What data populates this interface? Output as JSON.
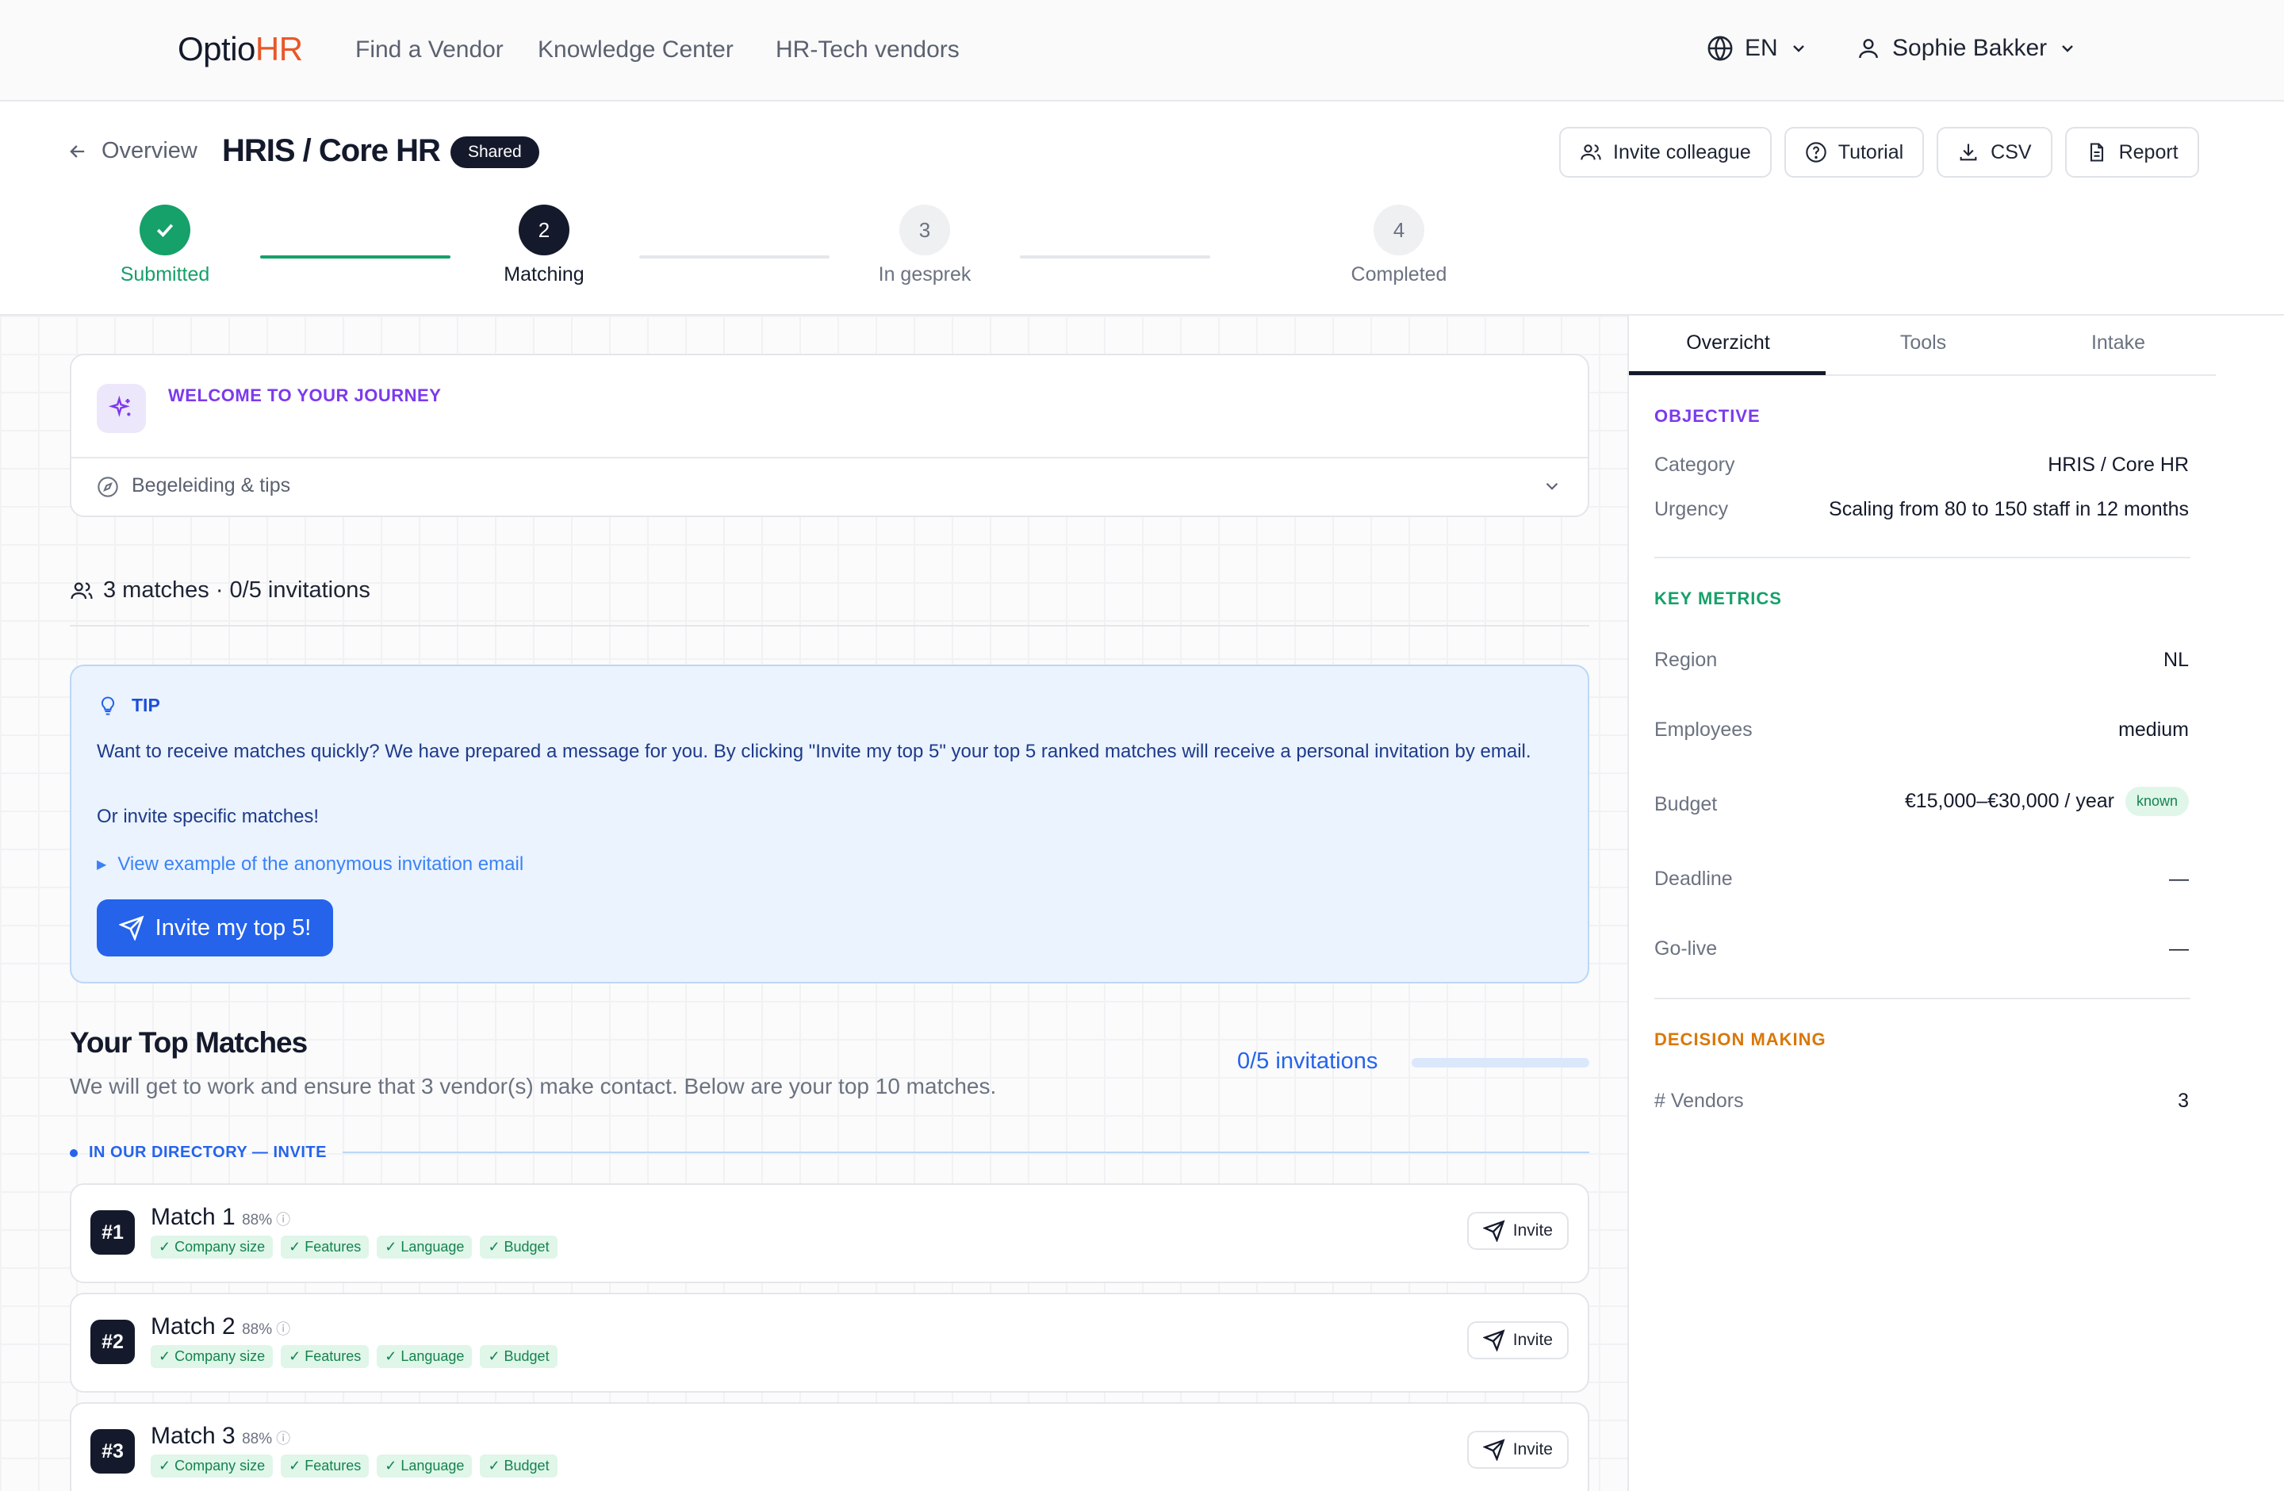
{
  "brand": {
    "part1": "Optio",
    "part2": "HR",
    "accent": "#e8572a"
  },
  "nav": {
    "items": [
      "Find a Vendor",
      "Knowledge Center",
      "HR-Tech vendors"
    ]
  },
  "lang": {
    "code": "EN"
  },
  "user": {
    "name": "Sophie Bakker"
  },
  "page": {
    "back_label": "Overview",
    "title": "HRIS / Core HR",
    "badge": "Shared"
  },
  "actions": {
    "invite": "Invite colleague",
    "tutorial": "Tutorial",
    "csv": "CSV",
    "report": "Report"
  },
  "steps": [
    {
      "num": "",
      "label": "Submitted",
      "state": "done"
    },
    {
      "num": "2",
      "label": "Matching",
      "state": "current"
    },
    {
      "num": "3",
      "label": "In gesprek",
      "state": "todo"
    },
    {
      "num": "4",
      "label": "Completed",
      "state": "todo"
    }
  ],
  "welcome": {
    "title": "WELCOME TO YOUR JOURNEY",
    "guide": "Begeleiding & tips"
  },
  "summary": {
    "text": "3 matches · 0/5 invitations"
  },
  "tip": {
    "title": "TIP",
    "line1": "Want to receive matches quickly? We have prepared a message for you. By clicking \"Invite my top 5\" your top 5 ranked matches will receive a personal invitation by email.",
    "line2": "Or invite specific matches!",
    "example": "View example of the anonymous invitation email",
    "cta": "Invite my top 5!"
  },
  "top": {
    "title": "Your Top Matches",
    "subtitle": "We will get to work and ensure that 3 vendor(s) make contact. Below are your top 10 matches.",
    "progress_label": "0/5 invitations",
    "progress": 0,
    "directory_label": "IN OUR DIRECTORY — INVITE"
  },
  "matches": [
    {
      "rank": "#1",
      "name": "Match 1",
      "score": "88%",
      "chips": [
        "✓ Company size",
        "✓ Features",
        "✓ Language",
        "✓ Budget"
      ],
      "action": "Invite"
    },
    {
      "rank": "#2",
      "name": "Match 2",
      "score": "88%",
      "chips": [
        "✓ Company size",
        "✓ Features",
        "✓ Language",
        "✓ Budget"
      ],
      "action": "Invite"
    },
    {
      "rank": "#3",
      "name": "Match 3",
      "score": "88%",
      "chips": [
        "✓ Company size",
        "✓ Features",
        "✓ Language",
        "✓ Budget"
      ],
      "action": "Invite"
    }
  ],
  "tabs": [
    "Overzicht",
    "Tools",
    "Intake"
  ],
  "objective": {
    "heading": "OBJECTIVE",
    "category_label": "Category",
    "category": "HRIS / Core HR",
    "urgency_label": "Urgency",
    "urgency": "Scaling from 80 to 150 staff in 12 months"
  },
  "metrics": {
    "heading": "KEY METRICS",
    "region_label": "Region",
    "region": "NL",
    "employees_label": "Employees",
    "employees": "medium",
    "budget_label": "Budget",
    "budget": "€15,000–€30,000 / year",
    "budget_badge": "known",
    "deadline_label": "Deadline",
    "deadline": "—",
    "golive_label": "Go-live",
    "golive": "—"
  },
  "decision": {
    "heading": "DECISION MAKING",
    "vendors_label": "# Vendors",
    "vendors": "3"
  },
  "colors": {
    "primary": "#2563eb",
    "navy": "#141a2b",
    "green": "#16a06a",
    "purple": "#7c3aed",
    "orange": "#d97706"
  }
}
